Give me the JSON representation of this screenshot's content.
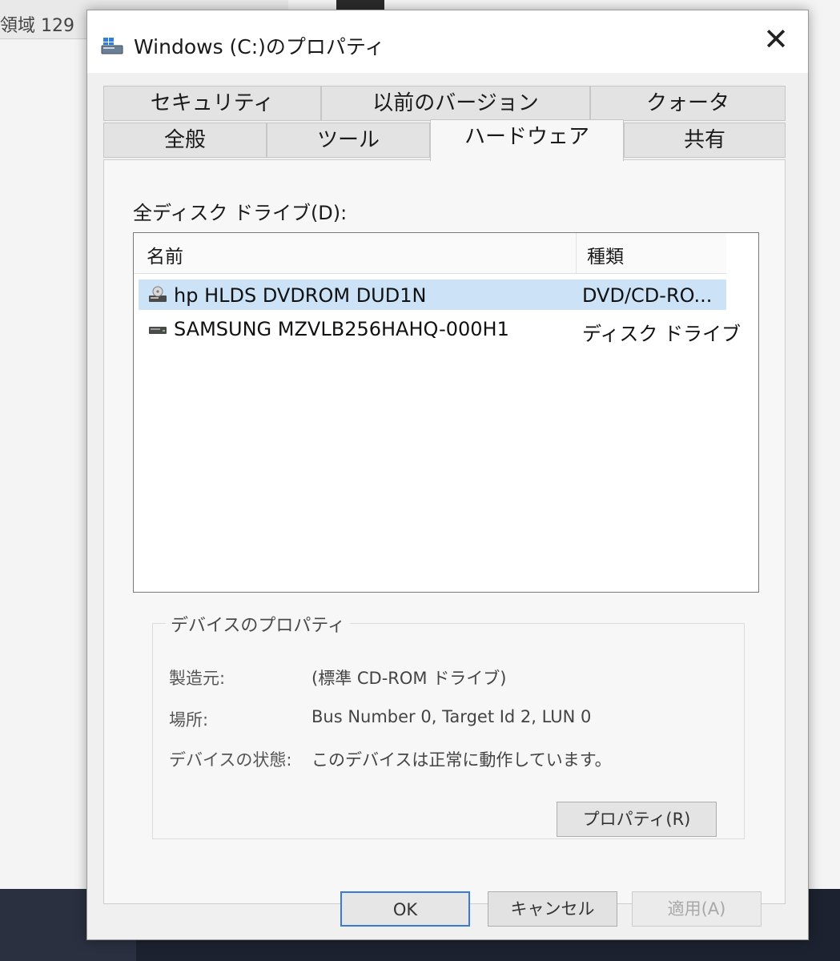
{
  "background": {
    "partial_text": "領域 129"
  },
  "dialog": {
    "title": "Windows (C:)のプロパティ",
    "close_glyph": "✕"
  },
  "tabs": {
    "row_back": [
      "セキュリティ",
      "以前のバージョン",
      "クォータ"
    ],
    "row_front": [
      "全般",
      "ツール",
      "ハードウェア",
      "共有"
    ],
    "active": "ハードウェア"
  },
  "hardware": {
    "list_label": "全ディスク ドライブ(D):",
    "columns": {
      "name": "名前",
      "type": "種類"
    },
    "rows": [
      {
        "name": "hp HLDS DVDROM DUD1N",
        "type": "DVD/CD-RO...",
        "icon": "optical-drive-icon",
        "selected": true
      },
      {
        "name": "SAMSUNG MZVLB256HAHQ-000H1",
        "type": "ディスク ドライブ",
        "icon": "hard-drive-icon",
        "selected": false
      }
    ],
    "device_props": {
      "title": "デバイスのプロパティ",
      "manufacturer_label": "製造元:",
      "manufacturer_value": "(標準 CD-ROM ドライブ)",
      "location_label": "場所:",
      "location_value": "Bus Number 0, Target Id 2, LUN 0",
      "status_label": "デバイスの状態:",
      "status_value": "このデバイスは正常に動作しています。",
      "properties_button": "プロパティ(R)"
    }
  },
  "footer": {
    "ok": "OK",
    "cancel": "キャンセル",
    "apply": "適用(A)"
  },
  "colors": {
    "selection": "#cce2f7",
    "default_button_border": "#3a7ad6"
  }
}
